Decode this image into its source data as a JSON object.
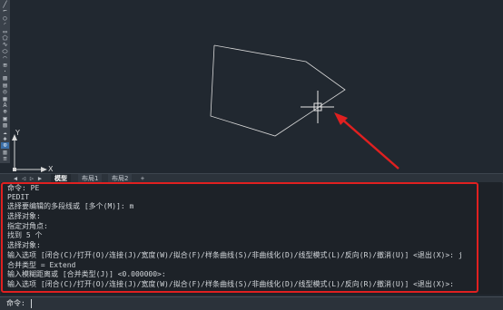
{
  "toolbar": {
    "tools": [
      {
        "icon": "line-icon",
        "glyph": "╱"
      },
      {
        "icon": "polyline-icon",
        "glyph": "⌐"
      },
      {
        "icon": "circle-icon",
        "glyph": "○"
      },
      {
        "icon": "arc-icon",
        "glyph": "◜"
      },
      {
        "icon": "rectangle-icon",
        "glyph": "▭"
      },
      {
        "icon": "polygon-icon",
        "glyph": "⬠"
      },
      {
        "icon": "spline-icon",
        "glyph": "∿"
      },
      {
        "icon": "ellipse-icon",
        "glyph": "⬭"
      },
      {
        "icon": "ellipse-arc-icon",
        "glyph": "◠"
      },
      {
        "icon": "block-icon",
        "glyph": "⊞"
      },
      {
        "icon": "point-icon",
        "glyph": "·"
      },
      {
        "icon": "hatch-icon",
        "glyph": "▨"
      },
      {
        "icon": "gradient-icon",
        "glyph": "▤"
      },
      {
        "icon": "region-icon",
        "glyph": "◎"
      },
      {
        "icon": "table-icon",
        "glyph": "▦"
      },
      {
        "icon": "mtext-icon",
        "glyph": "A"
      },
      {
        "icon": "insert-icon",
        "glyph": "⊕"
      },
      {
        "icon": "image-icon",
        "glyph": "▣"
      },
      {
        "icon": "wipeout-icon",
        "glyph": "▧"
      },
      {
        "icon": "revcloud-icon",
        "glyph": "☁"
      },
      {
        "icon": "select-icon",
        "glyph": "◈"
      },
      {
        "icon": "measure-icon",
        "glyph": "⊙"
      },
      {
        "icon": "layer-icon",
        "glyph": "▥"
      },
      {
        "icon": "properties-icon",
        "glyph": "≡"
      }
    ]
  },
  "ucs": {
    "x_label": "X",
    "y_label": "Y"
  },
  "tabs": {
    "nav": [
      "◀",
      "◁",
      "▷",
      "▶"
    ],
    "items": [
      {
        "label": "模型",
        "active": true
      },
      {
        "label": "布局1",
        "active": false
      },
      {
        "label": "布局2",
        "active": false
      }
    ],
    "add_label": "+"
  },
  "command_history": [
    "命令: PE",
    "PEDIT",
    "选择要编辑的多段线或 [多个(M)]: m",
    "选择对象:",
    "指定对角点:",
    "找到 5 个",
    "选择对象:",
    "输入选项 [闭合(C)/打开(O)/连接(J)/宽度(W)/拟合(F)/样条曲线(S)/非曲线化(D)/线型模式(L)/反向(R)/撤消(U)] <退出(X)>: j",
    "合并类型 = Extend",
    "输入模糊距离或 [合并类型(J)] <0.000000>:",
    "输入选项 [闭合(C)/打开(O)/连接(J)/宽度(W)/拟合(F)/样条曲线(S)/非曲线化(D)/线型模式(L)/反向(R)/撤消(U)] <退出(X)>:"
  ],
  "command_line": {
    "prompt": "命令:",
    "value": ""
  },
  "colors": {
    "canvas": "#212830",
    "geometry": "#d8d8d8",
    "annotation_red": "#e02020",
    "axis": "#d8d8d8"
  }
}
